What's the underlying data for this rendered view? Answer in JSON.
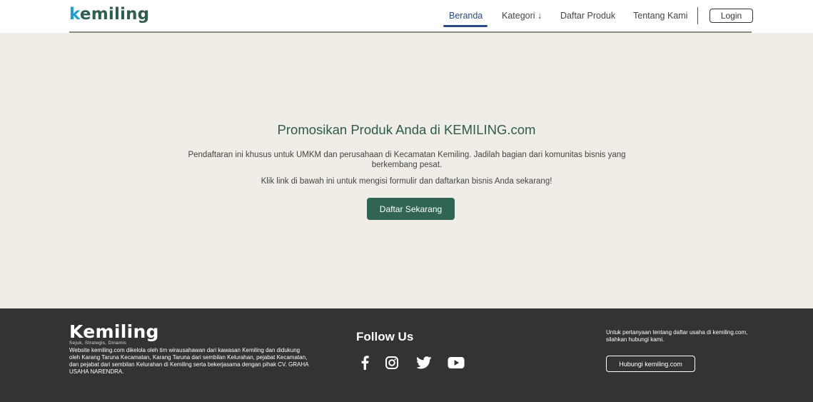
{
  "brand": {
    "name": "Kemiling",
    "logo_k": "k",
    "logo_rest": "emiling",
    "tagline": "Sejuk, Strategis, Dinamis"
  },
  "nav": {
    "items": [
      "Beranda",
      "Kategori ↓",
      "Daftar Produk",
      "Tentang Kami"
    ],
    "active": "Beranda",
    "login_label": "Login"
  },
  "hero": {
    "title": "Promosikan Produk Anda di KEMILING.com",
    "paragraph1": "Pendaftaran ini khusus untuk UMKM dan perusahaan di Kecamatan Kemiling. Jadilah bagian dari komunitas bisnis yang berkembang pesat.",
    "paragraph2": "Klik link di bawah ini untuk mengisi formulir dan daftarkan bisnis Anda sekarang!",
    "cta_label": "Daftar Sekarang"
  },
  "footer": {
    "description": "Website kemiling.com dikelola oleh tim wirausahawan dari kawasan Kemiling dan didukung oleh Karang Taruna Kecamatan, Karang Taruna dari sembilan Kelurahan, pejabat Kecamatan, dan pejabat dari sembilan Kelurahan di Kemiling serta bekerjasama dengan pihak CV. GRAHA USAHA NARENDRA.",
    "follow_title": "Follow Us",
    "social_icons": [
      "facebook-icon",
      "instagram-icon",
      "twitter-icon",
      "youtube-icon"
    ],
    "contact_text": "Untuk pertanyaan tentang daftar usaha di kemiling.com, silahkan hubungi kami.",
    "contact_button": "Hubungi kemiling.com"
  },
  "colors": {
    "brand_green": "#2f5d50",
    "brand_blue": "#1f9cd6",
    "cta_green": "#2f6552",
    "page_bg": "#f0ede6",
    "footer_bg": "#333333",
    "nav_active": "#2c4b8b"
  }
}
